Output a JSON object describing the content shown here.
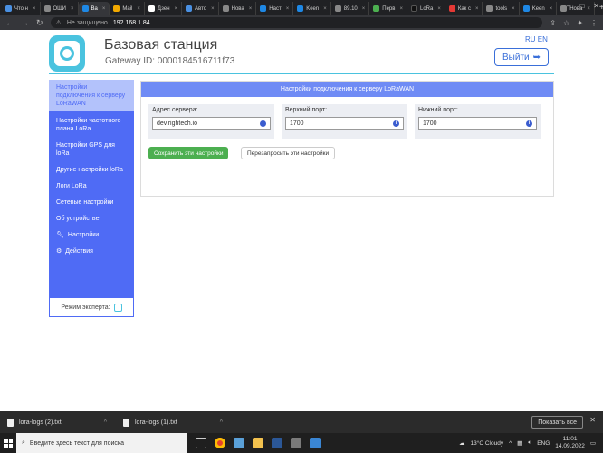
{
  "browser": {
    "tabs": [
      {
        "label": "Что н",
        "color": "#4a90e2"
      },
      {
        "label": "ОШИ",
        "color": "#888"
      },
      {
        "label": "Ва",
        "color": "#1e88e5",
        "active": true
      },
      {
        "label": "Mail",
        "color": "#f2a900"
      },
      {
        "label": "Дзен",
        "color": "#fff"
      },
      {
        "label": "Авто",
        "color": "#4a90e2"
      },
      {
        "label": "Нова",
        "color": "#888"
      },
      {
        "label": "Наст",
        "color": "#1e88e5"
      },
      {
        "label": "Keen",
        "color": "#1e88e5"
      },
      {
        "label": "89.10",
        "color": "#888"
      },
      {
        "label": "Перв",
        "color": "#4caf50"
      },
      {
        "label": "LoRa",
        "color": "#111"
      },
      {
        "label": "Как с",
        "color": "#e53935"
      },
      {
        "label": "tools",
        "color": "#888"
      },
      {
        "label": "Keen",
        "color": "#1e88e5"
      },
      {
        "label": "Нова",
        "color": "#888"
      }
    ],
    "not_secure": "Не защищено",
    "url": "192.168.1.84"
  },
  "header": {
    "title": "Базовая станция",
    "gateway_id": "Gateway ID: 0000184516711f73",
    "lang_ru": "RU",
    "lang_en": "EN",
    "logout_label": "Выйти"
  },
  "sidebar": {
    "items": [
      {
        "label": "Настройки подключения к серверу LoRaWAN"
      },
      {
        "label": "Настройки частотного плана LoRa"
      },
      {
        "label": "Настройки GPS для loRa"
      },
      {
        "label": "Другие настройки loRa"
      },
      {
        "label": "Логи LoRa"
      },
      {
        "label": "Сетевые настройки"
      },
      {
        "label": "Об устройстве"
      },
      {
        "label": "Настройки"
      },
      {
        "label": "Действия"
      }
    ],
    "expert_mode": "Режим эксперта:"
  },
  "panel": {
    "title": "Настройки подключения к серверу LoRaWAN",
    "fields": [
      {
        "label": "Адрес сервера:",
        "value": "dev.rightech.io"
      },
      {
        "label": "Верхний порт:",
        "value": "1700"
      },
      {
        "label": "Нижний порт:",
        "value": "1700"
      }
    ],
    "save_label": "Сохранить эти настройки",
    "request_label": "Перезапросить эти настройки"
  },
  "downloads": {
    "items": [
      {
        "label": "lora-logs (2).txt"
      },
      {
        "label": "lora-logs (1).txt"
      }
    ],
    "show_all": "Показать все"
  },
  "taskbar": {
    "search_placeholder": "Введите здесь текст для поиска",
    "weather": "13°C Cloudy",
    "lang": "ENG",
    "time": "11:01",
    "date": "14.09.2022"
  }
}
